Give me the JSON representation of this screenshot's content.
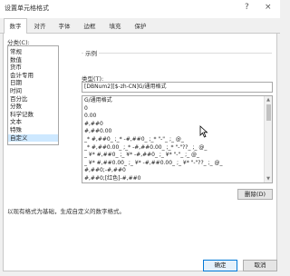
{
  "window": {
    "title": "设置单元格格式",
    "help": "?",
    "close": "×"
  },
  "tabs": [
    {
      "label": "数字"
    },
    {
      "label": "对齐"
    },
    {
      "label": "字体"
    },
    {
      "label": "边框"
    },
    {
      "label": "填充"
    },
    {
      "label": "保护"
    }
  ],
  "category": {
    "label": "分类(C):",
    "items": [
      "常规",
      "数值",
      "货币",
      "会计专用",
      "日期",
      "时间",
      "百分比",
      "分数",
      "科学记数",
      "文本",
      "特殊",
      "自定义"
    ],
    "selected_index": 11
  },
  "sample": {
    "label": "示例"
  },
  "type_field": {
    "label": "类型(T):",
    "value": "[DBNum2][$-zh-CN]G/通用格式"
  },
  "formats": [
    "G/通用格式",
    "0",
    "0.00",
    "#,##0",
    "#,##0.00",
    "_* #,##0_ ;_* -#,##0_ ;_* \"-\"_ ;_ @_ ",
    "_* #,##0.00_ ;_* -#,##0.00_ ;_* \"-\"??_ ;_ @_ ",
    "_ ¥* #,##0_ ;_ ¥* -#,##0_ ;_ ¥* \"-\"_ ;_ @_ ",
    "_ ¥* #,##0.00_ ;_ ¥* -#,##0.00_ ;_ ¥* \"-\"??_ ;_ @_ ",
    "#,##0;-#,##0",
    "#,##0;[红色]-#,##0"
  ],
  "buttons": {
    "delete": "删除(D)",
    "ok": "确定",
    "cancel": "取消"
  },
  "description": "以现有格式为基础，生成自定义的数字格式。",
  "colors": {
    "selection": "#cde8ff",
    "border": "#a8a8a8"
  }
}
